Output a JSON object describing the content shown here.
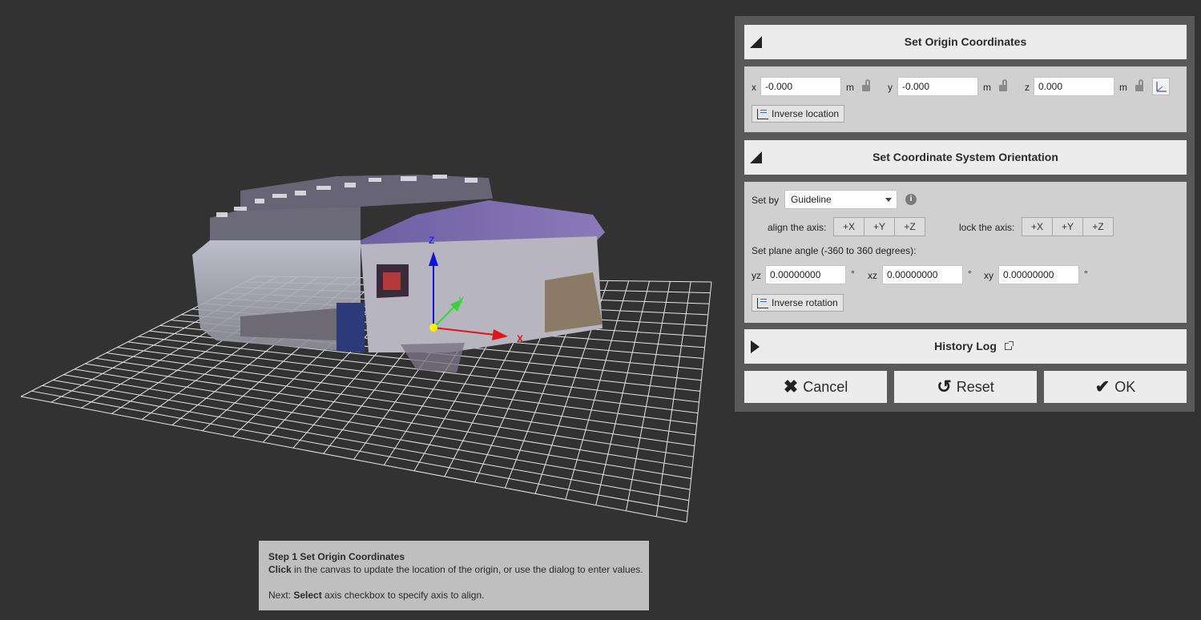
{
  "axis_labels": {
    "z": "Z",
    "y": "Y",
    "x": "X"
  },
  "origin_section": {
    "title": "Set Origin Coordinates",
    "x_label": "x",
    "x_value": "-0.000",
    "y_label": "y",
    "y_value": "-0.000",
    "z_label": "z",
    "z_value": "0.000",
    "unit": "m",
    "inverse_label": "Inverse location"
  },
  "orientation_section": {
    "title": "Set Coordinate System Orientation",
    "set_by_label": "Set by",
    "set_by_value": "Guideline",
    "info_glyph": "i",
    "align_label": "align the axis:",
    "lock_label": "lock the axis:",
    "axes": [
      "+X",
      "+Y",
      "+Z"
    ],
    "plane_angle_label": "Set plane angle (-360 to 360 degrees):",
    "yz_label": "yz",
    "yz_value": "0.00000000",
    "xz_label": "xz",
    "xz_value": "0.00000000",
    "xy_label": "xy",
    "xy_value": "0.00000000",
    "degree": "°",
    "inverse_label": "Inverse rotation"
  },
  "history_section": {
    "title": "History Log"
  },
  "buttons": {
    "cancel": "Cancel",
    "reset": "Reset",
    "ok": "OK"
  },
  "icons": {
    "cancel": "close-icon",
    "reset": "undo-icon",
    "ok": "check-icon",
    "lock": "unlock-icon",
    "external": "external-link-icon"
  },
  "hint": {
    "step_title": "Step 1 Set Origin Coordinates",
    "click_word": "Click",
    "line1_rest": " in the canvas to update the location of the origin, or use the dialog to enter values.",
    "next_prefix": "Next: ",
    "select_word": "Select",
    "next_rest": " axis checkbox to specify axis to align."
  },
  "colors": {
    "background": "#323232",
    "dialog_frame": "#595959",
    "header": "#ececec",
    "body": "#d0d0d0",
    "x_axis": "#e01515",
    "y_axis": "#3cd13c",
    "z_axis": "#1212e0",
    "origin": "#ffee00"
  }
}
